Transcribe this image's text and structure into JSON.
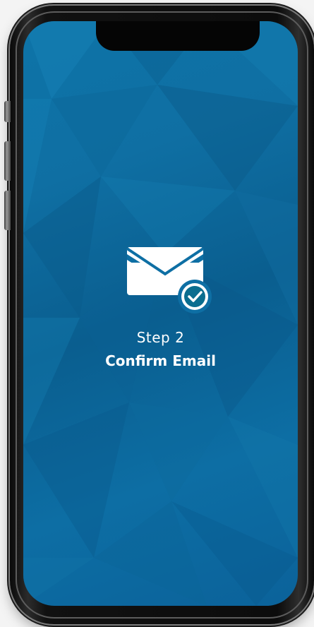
{
  "onboarding": {
    "step_label": "Step 2",
    "step_title": "Confirm Email",
    "icon": "envelope-check-icon"
  },
  "colors": {
    "screen_background": "#0e6fa4",
    "icon_foreground": "#ffffff",
    "check_badge": "#0a6d8f",
    "phone_frame": "#111111"
  }
}
